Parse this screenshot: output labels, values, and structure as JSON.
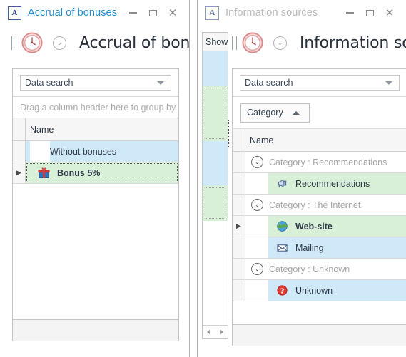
{
  "windows": [
    {
      "id": "accrual",
      "titlebar": {
        "app_icon": "application-a-icon",
        "title": "Accrual of bonuses",
        "active": true,
        "minimize_label": "Minimize",
        "maximize_label": "Maximize",
        "close_label": "Close"
      },
      "form_header": {
        "icon": "clock-icon",
        "dropdown_icon": "navigation-dropdown-icon",
        "caption": "Accrual of bonu"
      },
      "search": {
        "value": "Data search",
        "placeholder": "Data search",
        "dropdown_icon": "caret-down-icon"
      },
      "group_hint": "Drag a column header here to group by that c",
      "grid": {
        "columns": [
          "Name"
        ],
        "rows": [
          {
            "name": "Without bonuses",
            "icon": "",
            "indent": 1,
            "highlight": "blue",
            "focused": false,
            "bold": false,
            "indicator": ""
          },
          {
            "name": "Bonus 5%",
            "icon": "gift-icon",
            "indent": 1,
            "highlight": "green",
            "focused": true,
            "bold": true,
            "indicator": "current-row-arrow"
          }
        ]
      }
    },
    {
      "id": "sources",
      "titlebar": {
        "app_icon": "application-a-icon",
        "title": "Information sources",
        "active": false,
        "minimize_label": "Minimize",
        "maximize_label": "Maximize",
        "close_label": "Close"
      },
      "form_header": {
        "icon": "clock-icon",
        "dropdown_icon": "navigation-dropdown-icon",
        "caption": "Information sou"
      },
      "show_strip": {
        "header": "Show",
        "hscroll": {
          "left_arrow": "scroll-left-icon",
          "right_arrow": "scroll-right-icon"
        }
      },
      "search": {
        "value": "Data search",
        "placeholder": "Data search",
        "dropdown_icon": "caret-down-icon"
      },
      "group_panel": {
        "chip_label": "Category",
        "sort_icon": "caret-up-icon"
      },
      "grid": {
        "columns": [
          "Name"
        ],
        "rows": [
          {
            "type": "group",
            "name": "Category : Recommendations",
            "expander": "collapse-icon"
          },
          {
            "type": "data",
            "name": "Recommendations",
            "icon": "megaphone-icon",
            "indent": 1,
            "highlight": "green",
            "focused": false,
            "bold": false,
            "indicator": ""
          },
          {
            "type": "group",
            "name": "Category : The Internet",
            "expander": "collapse-icon"
          },
          {
            "type": "data",
            "name": "Web-site",
            "icon": "globe-icon",
            "indent": 1,
            "highlight": "green",
            "focused": false,
            "bold": true,
            "indicator": "current-row-arrow"
          },
          {
            "type": "data",
            "name": "Mailing",
            "icon": "envelope-icon",
            "indent": 1,
            "highlight": "blue",
            "focused": false,
            "bold": false,
            "indicator": ""
          },
          {
            "type": "group",
            "name": "Category : Unknown",
            "expander": "collapse-icon"
          },
          {
            "type": "data",
            "name": "Unknown",
            "icon": "question-mark-icon",
            "indent": 1,
            "highlight": "blue",
            "focused": false,
            "bold": false,
            "indicator": ""
          }
        ]
      }
    }
  ],
  "colors": {
    "title_active": "#1e90d8",
    "title_inactive": "#b9b9b9",
    "row_blue": "#cfe9f9",
    "row_green": "#d8f0d8",
    "header_bg": "#f6f6f6",
    "border": "#c6c6c6"
  },
  "glyphs": {
    "collapse": "⌄",
    "current_row": "▶",
    "close": "✕"
  }
}
